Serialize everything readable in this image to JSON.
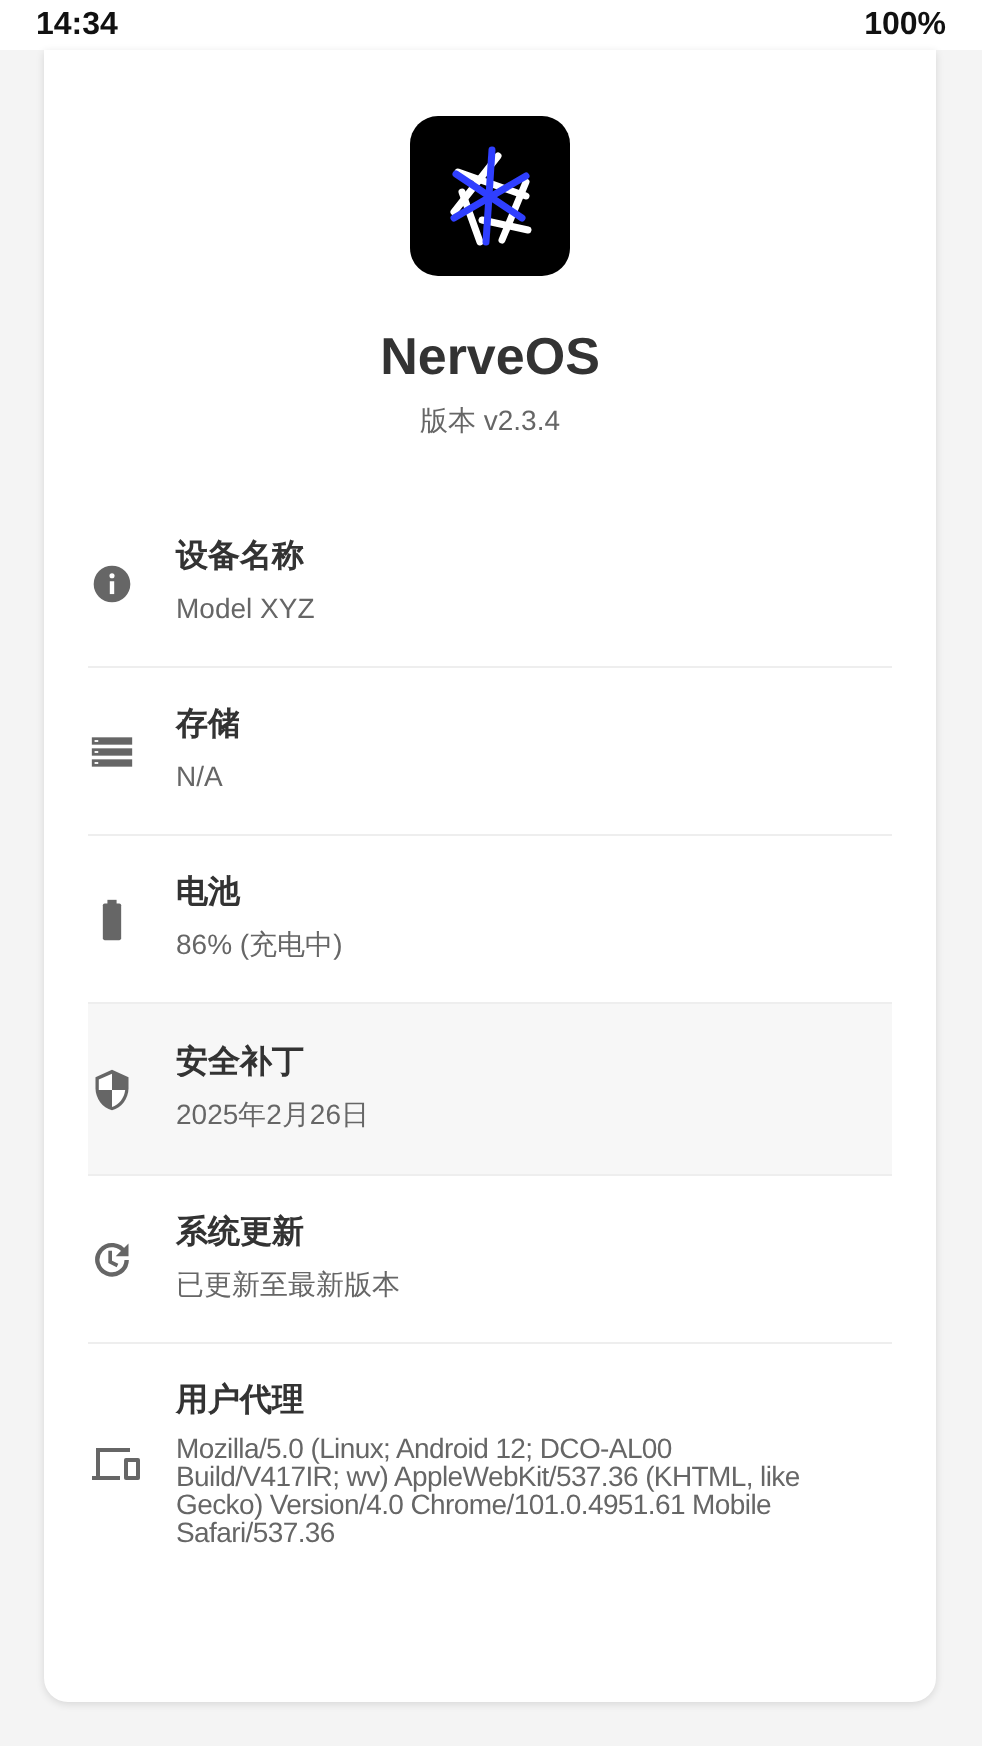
{
  "status_bar": {
    "time": "14:34",
    "battery": "100%"
  },
  "app": {
    "name": "NerveOS",
    "version": "版本 v2.3.4"
  },
  "rows": [
    {
      "title": "设备名称",
      "value": "Model XYZ",
      "selected": false
    },
    {
      "title": "存储",
      "value": "N/A",
      "selected": false
    },
    {
      "title": "电池",
      "value": "86% (充电中)",
      "selected": false
    },
    {
      "title": "安全补丁",
      "value": "2025年2月26日",
      "selected": true
    },
    {
      "title": "系统更新",
      "value": "已更新至最新版本",
      "selected": false
    },
    {
      "title": "用户代理",
      "value": "Mozilla/5.0 (Linux; Android 12; DCO-AL00 Build/V417IR; wv) AppleWebKit/537.36 (KHTML, like Gecko) Version/4.0 Chrome/101.0.4951.61 Mobile Safari/537.36",
      "selected": false
    }
  ]
}
